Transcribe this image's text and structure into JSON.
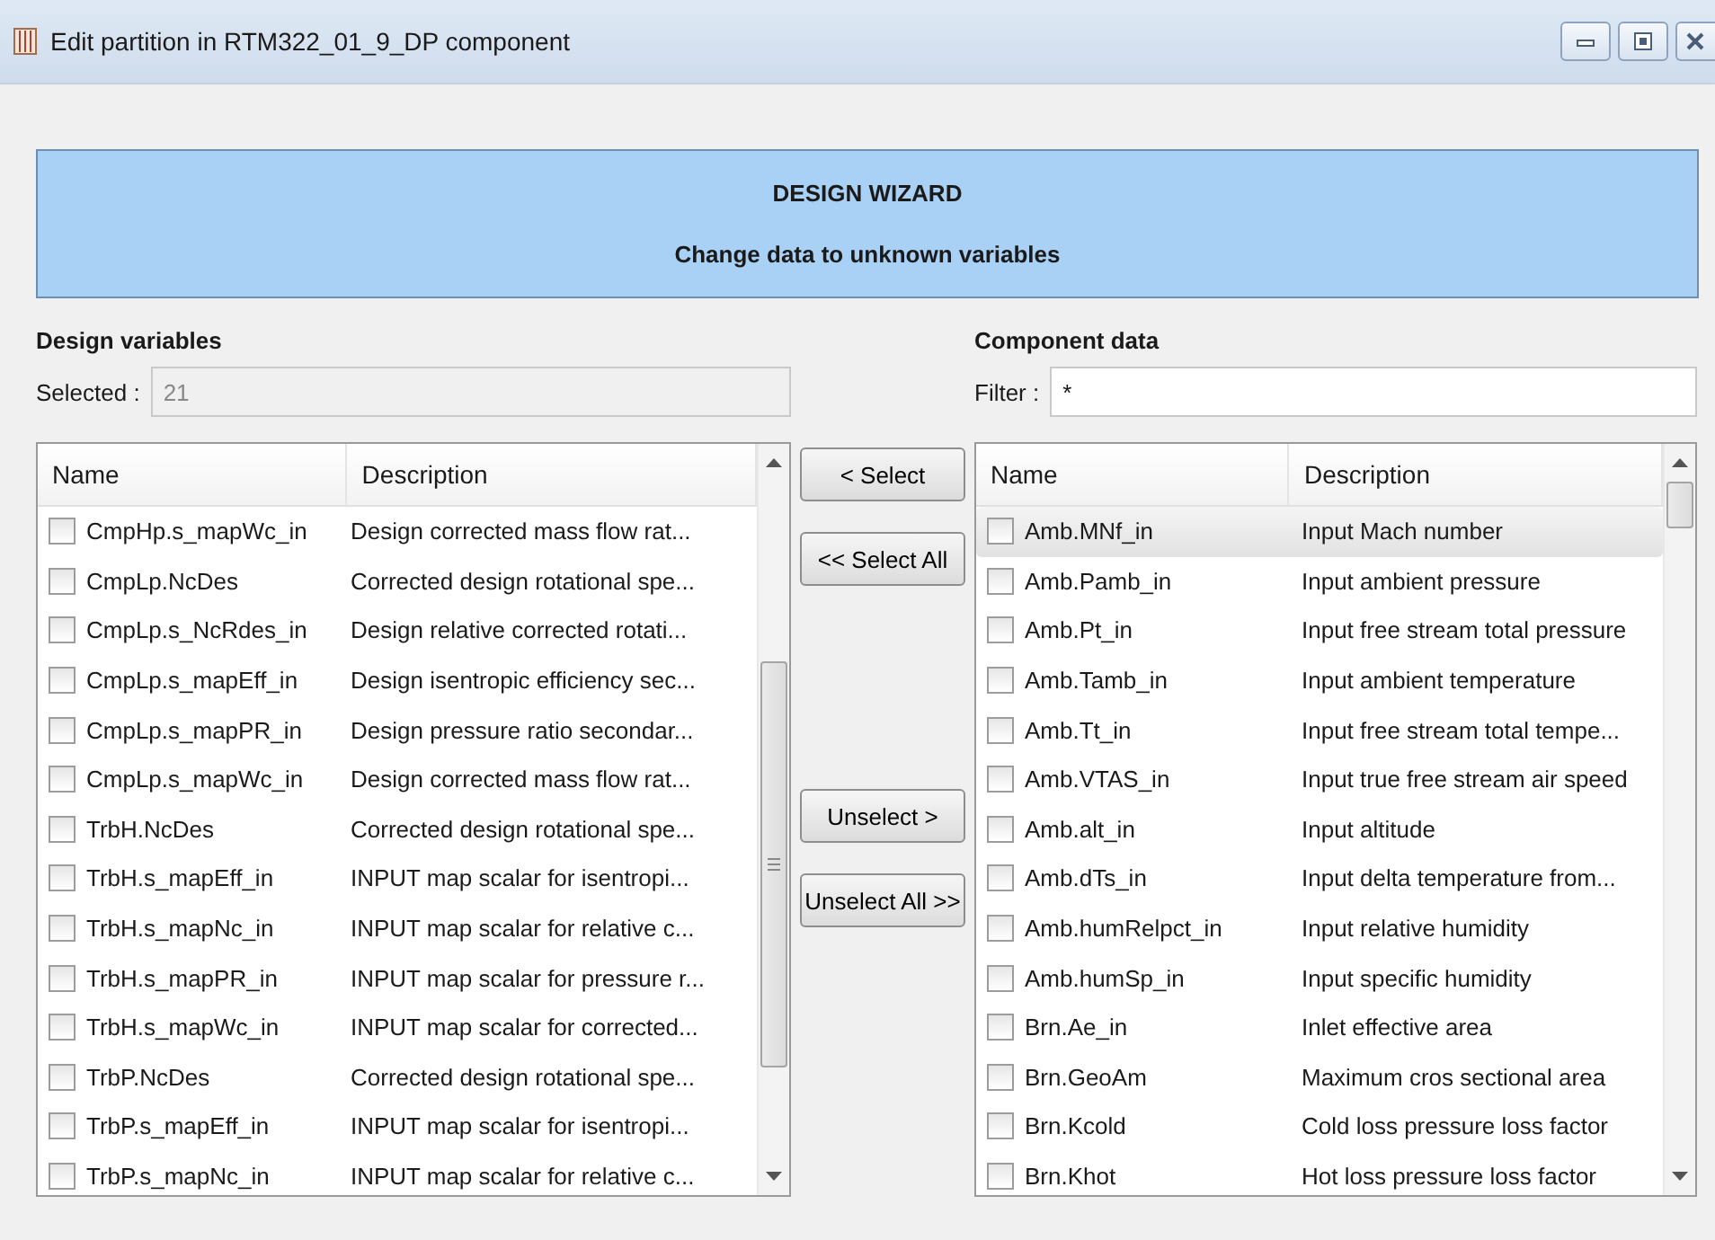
{
  "window": {
    "title": "Edit partition in RTM322_01_9_DP component"
  },
  "banner": {
    "title": "DESIGN WIZARD",
    "subtitle": "Change data to unknown variables"
  },
  "design_variables": {
    "heading": "Design variables",
    "selected_label": "Selected :",
    "selected_value": "21",
    "columns": [
      "Name",
      "Description"
    ],
    "rows": [
      {
        "name": "CmpHp.s_mapWc_in",
        "description": "Design corrected mass flow rat...",
        "checked": false,
        "selected": false
      },
      {
        "name": "CmpLp.NcDes",
        "description": "Corrected design rotational spe...",
        "checked": false,
        "selected": false
      },
      {
        "name": "CmpLp.s_NcRdes_in",
        "description": "Design relative corrected rotati...",
        "checked": false,
        "selected": false
      },
      {
        "name": "CmpLp.s_mapEff_in",
        "description": "Design isentropic efficiency sec...",
        "checked": false,
        "selected": false
      },
      {
        "name": "CmpLp.s_mapPR_in",
        "description": "Design pressure ratio secondar...",
        "checked": false,
        "selected": false
      },
      {
        "name": "CmpLp.s_mapWc_in",
        "description": "Design corrected mass flow rat...",
        "checked": false,
        "selected": false
      },
      {
        "name": "TrbH.NcDes",
        "description": "Corrected design rotational spe...",
        "checked": false,
        "selected": false
      },
      {
        "name": "TrbH.s_mapEff_in",
        "description": "INPUT map scalar for isentropi...",
        "checked": false,
        "selected": false
      },
      {
        "name": "TrbH.s_mapNc_in",
        "description": "INPUT map scalar for relative c...",
        "checked": false,
        "selected": false
      },
      {
        "name": "TrbH.s_mapPR_in",
        "description": "INPUT map scalar for pressure r...",
        "checked": false,
        "selected": false
      },
      {
        "name": "TrbH.s_mapWc_in",
        "description": "INPUT map scalar for corrected...",
        "checked": false,
        "selected": false
      },
      {
        "name": "TrbP.NcDes",
        "description": "Corrected design rotational spe...",
        "checked": false,
        "selected": false
      },
      {
        "name": "TrbP.s_mapEff_in",
        "description": "INPUT map scalar for isentropi...",
        "checked": false,
        "selected": false
      },
      {
        "name": "TrbP.s_mapNc_in",
        "description": "INPUT map scalar for relative c...",
        "checked": false,
        "selected": false
      }
    ]
  },
  "buttons": [
    "< Select",
    "<< Select All",
    "Unselect >",
    "Unselect All >>"
  ],
  "component_data": {
    "heading": "Component data",
    "filter_label": "Filter :",
    "filter_value": "*",
    "columns": [
      "Name",
      "Description"
    ],
    "rows": [
      {
        "name": "Amb.MNf_in",
        "description": "Input Mach number",
        "checked": false,
        "selected": true
      },
      {
        "name": "Amb.Pamb_in",
        "description": "Input ambient pressure",
        "checked": false,
        "selected": false
      },
      {
        "name": "Amb.Pt_in",
        "description": "Input free stream total pressure",
        "checked": false,
        "selected": false
      },
      {
        "name": "Amb.Tamb_in",
        "description": "Input ambient temperature",
        "checked": false,
        "selected": false
      },
      {
        "name": "Amb.Tt_in",
        "description": "Input free stream total tempe...",
        "checked": false,
        "selected": false
      },
      {
        "name": "Amb.VTAS_in",
        "description": "Input true free stream air speed",
        "checked": false,
        "selected": false
      },
      {
        "name": "Amb.alt_in",
        "description": "Input altitude",
        "checked": false,
        "selected": false
      },
      {
        "name": "Amb.dTs_in",
        "description": "Input delta temperature from...",
        "checked": false,
        "selected": false
      },
      {
        "name": "Amb.humRelpct_in",
        "description": "Input relative humidity",
        "checked": false,
        "selected": false
      },
      {
        "name": "Amb.humSp_in",
        "description": "Input specific humidity",
        "checked": false,
        "selected": false
      },
      {
        "name": "Brn.Ae_in",
        "description": "Inlet effective area",
        "checked": false,
        "selected": false
      },
      {
        "name": "Brn.GeoAm",
        "description": "Maximum cros sectional area",
        "checked": false,
        "selected": false
      },
      {
        "name": "Brn.Kcold",
        "description": "Cold loss pressure loss factor",
        "checked": false,
        "selected": false
      },
      {
        "name": "Brn.Khot",
        "description": "Hot loss pressure loss factor",
        "checked": false,
        "selected": false
      }
    ]
  }
}
